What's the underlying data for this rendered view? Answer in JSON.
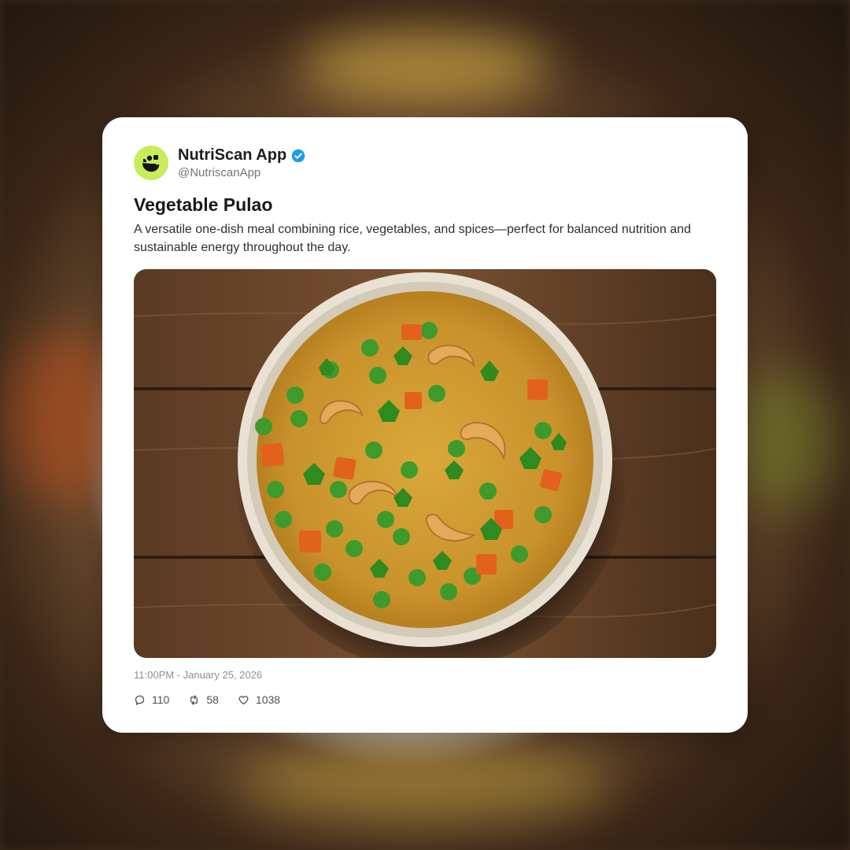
{
  "post": {
    "account_name": "NutriScan App",
    "handle": "@NutriscanApp",
    "title": "Vegetable Pulao",
    "description": "A versatile one-dish meal combining rice, vegetables, and spices—perfect for balanced nutrition and sustainable energy throughout the day.",
    "timestamp": "11:00PM - January 25, 2026",
    "stats": {
      "replies": "110",
      "reposts": "58",
      "likes": "1038"
    }
  },
  "icons": {
    "avatar": "nutriscan-logo-icon",
    "verified": "verified-badge-icon",
    "reply": "comment-icon",
    "repost": "repost-icon",
    "like": "heart-icon"
  },
  "colors": {
    "avatar_bg": "#c8ec5b",
    "verified": "#1d9bf0",
    "card_bg": "#ffffff"
  }
}
